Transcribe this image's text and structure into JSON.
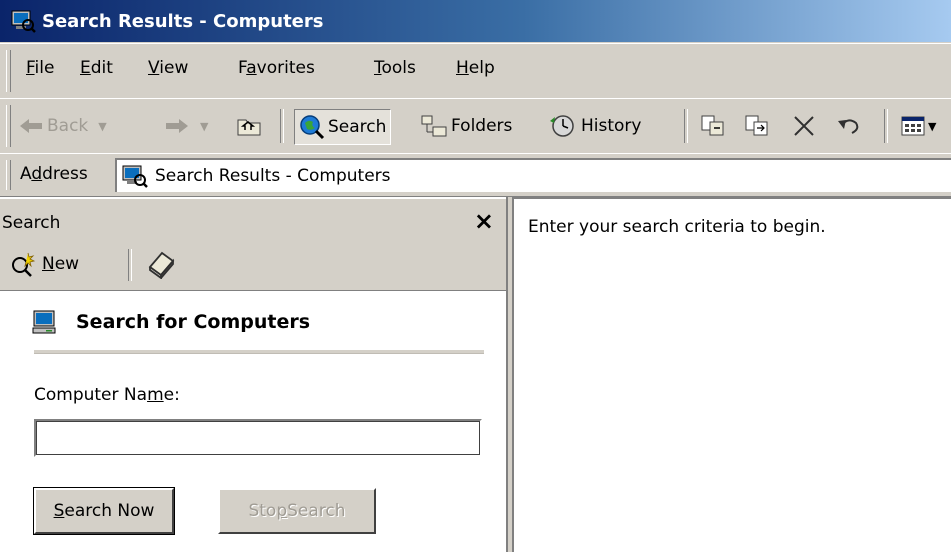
{
  "window": {
    "title": "Search Results - Computers"
  },
  "menu": {
    "items": [
      {
        "pre": "",
        "ul": "F",
        "post": "ile"
      },
      {
        "pre": "",
        "ul": "E",
        "post": "dit"
      },
      {
        "pre": "",
        "ul": "V",
        "post": "iew"
      },
      {
        "pre": "F",
        "ul": "a",
        "post": "vorites"
      },
      {
        "pre": "",
        "ul": "T",
        "post": "ools"
      },
      {
        "pre": "",
        "ul": "H",
        "post": "elp"
      }
    ]
  },
  "toolbar": {
    "back_label": "Back",
    "search_label": "Search",
    "folders_label": "Folders",
    "history_label": "History"
  },
  "address": {
    "label_pre": "A",
    "label_ul": "d",
    "label_post": "dress",
    "value": "Search Results - Computers"
  },
  "search_pane": {
    "title": "Search",
    "close_glyph": "×",
    "new_pre": "",
    "new_ul": "N",
    "new_post": "ew",
    "heading": "Search for Computers",
    "field_label_pre": "Computer Na",
    "field_label_ul": "m",
    "field_label_post": "e:",
    "name_value": "",
    "search_now_pre": "",
    "search_now_ul": "S",
    "search_now_post": "earch Now",
    "stop_pre": "Sto",
    "stop_ul": "p",
    "stop_post": " Search"
  },
  "results": {
    "message": "Enter your search criteria to begin."
  },
  "colors": {
    "title_gradient_start": "#0a246a",
    "title_gradient_end": "#a6caf0",
    "chrome": "#d4d0c8"
  },
  "icons": {
    "app": "computer-search-icon",
    "back": "back-arrow-icon",
    "forward": "forward-arrow-icon",
    "up": "up-folder-icon",
    "search": "search-globe-icon",
    "folders": "folders-icon",
    "history": "history-icon",
    "move_to": "move-to-icon",
    "copy_to": "copy-to-icon",
    "delete": "delete-icon",
    "undo": "undo-icon",
    "views": "views-icon",
    "new": "new-search-icon",
    "help": "help-book-icon"
  }
}
